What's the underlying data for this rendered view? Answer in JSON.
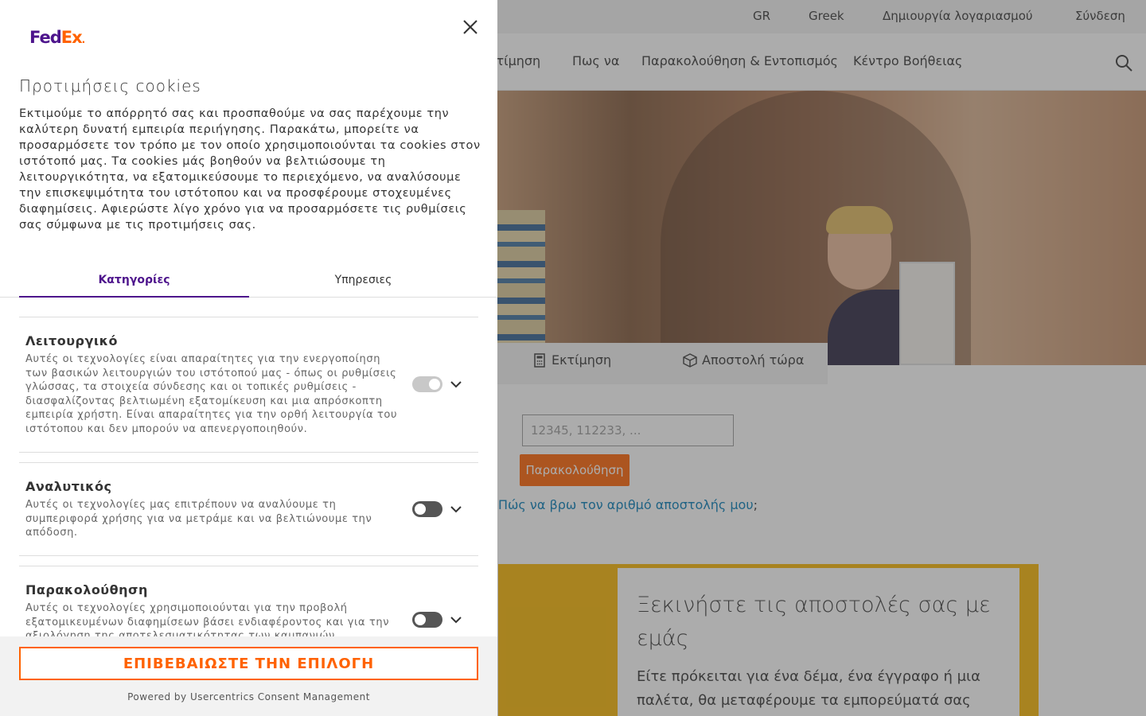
{
  "site": {
    "topbar": {
      "region": "GR",
      "language": "Greek",
      "create_account": "Δημιουργία λογαριασμού",
      "login": "Σύνδεση"
    },
    "nav": {
      "items": [
        "Εκτίμηση",
        "Πως να",
        "Παρακολούθηση & Εντοπισμός",
        "Κέντρο Βοήθειας"
      ],
      "search_icon": "search-icon"
    },
    "hero_tabs": {
      "estimate": "Εκτίμηση",
      "ship_now": "Αποστολή τώρα"
    },
    "tracking": {
      "input_placeholder": "12345, 112233, ...",
      "button": "Παρακολούθηση",
      "help_link": "Πώς να βρω τον αριθμό αποστολής μου",
      "help_link_suffix": ";"
    },
    "promo": {
      "title": "Ξεκινήστε τις αποστολές σας με εμάς",
      "text": "Είτε πρόκειται για ένα δέμα, ένα έγγραφο ή μια παλέτα, θα μεταφέρουμε τα εμπορεύματά σας εκεί"
    }
  },
  "cookie_panel": {
    "logo": {
      "fed": "Fed",
      "ex": "Ex",
      "dot": "."
    },
    "title": "Προτιμήσεις cookies",
    "description": "Εκτιμούμε το απόρρητό σας και προσπαθούμε να σας παρέχουμε την καλύτερη δυνατή εμπειρία περιήγησης. Παρακάτω, μπορείτε να προσαρμόσετε τον τρόπο με τον οποίο χρησιμοποιούνται τα cookies στον ιστότοπό μας. Τα cookies μάς βοηθούν να βελτιώσουμε τη λειτουργικότητα, να εξατομικεύσουμε το περιεχόμενο, να αναλύσουμε την επισκεψιμότητα του ιστότοπου και να προσφέρουμε στοχευμένες διαφημίσεις. Αφιερώστε λίγο χρόνο για να προσαρμόσετε τις ρυθμίσεις σας σύμφωνα με τις προτιμήσεις σας.",
    "tabs": [
      {
        "label": "Κατηγορίες",
        "active": true
      },
      {
        "label": "Υπηρεσιες",
        "active": false
      }
    ],
    "categories": [
      {
        "title": "Λειτουργικό",
        "description": "Αυτές οι τεχνολογίες είναι απαραίτητες για την ενεργοποίηση των βασικών λειτουργιών του ιστότοπού μας - όπως οι ρυθμίσεις γλώσσας, τα στοιχεία σύνδεσης και οι τοπικές ρυθμίσεις - διασφαλίζοντας βελτιωμένη εξατομίκευση και μια απρόσκοπτη εμπειρία χρήστη. Είναι απαραίτητες για την ορθή λειτουργία του ιστότοπου και δεν μπορούν να απενεργοποιηθούν.",
        "enabled": true,
        "locked": true
      },
      {
        "title": "Αναλυτικός",
        "description": "Αυτές οι τεχνολογίες μας επιτρέπουν να αναλύουμε τη συμπεριφορά χρήσης για να μετράμε και να βελτιώνουμε την απόδοση.",
        "enabled": false,
        "locked": false
      },
      {
        "title": "Παρακολούθηση",
        "description": "Αυτές οι τεχνολογίες χρησιμοποιούνται για την προβολή εξατομικευμένων διαφημίσεων βάσει ενδιαφέροντος και για την αξιολόγηση της αποτελεσματικότητας των καμπανιών.",
        "enabled": false,
        "locked": false
      }
    ],
    "confirm_button": "ΕΠΙΒΕΒΑΙΩΣΤΕ ΤΗΝ ΕΠΙΛΟΓΗ",
    "powered_by": "Powered by Usercentrics Consent Management",
    "colors": {
      "purple": "#4d148c",
      "orange": "#ff6200"
    }
  }
}
